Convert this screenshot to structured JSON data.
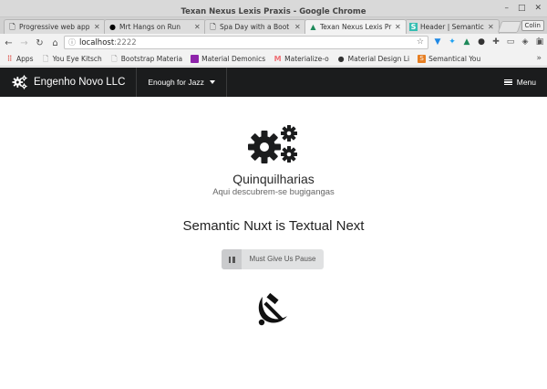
{
  "window": {
    "title": "Texan Nexus Lexis Praxis - Google Chrome"
  },
  "tabs": [
    {
      "label": "Progressive web app",
      "icon": "page-icon",
      "active": false
    },
    {
      "label": "Mrt Hangs on Run",
      "icon": "github-icon",
      "active": false
    },
    {
      "label": "Spa Day with a Boot",
      "icon": "page-icon",
      "active": false
    },
    {
      "label": "Texan Nexus Lexis Pr",
      "icon": "nuxt-icon",
      "active": true
    },
    {
      "label": "Header | Semantic U",
      "icon": "semantic-icon",
      "active": false
    }
  ],
  "profile_badge": "Colin",
  "address": {
    "host": "localhost",
    "port": ":2222"
  },
  "bookmarks": [
    {
      "label": "Apps",
      "icon": "apps-grid-icon",
      "color": "#d93025"
    },
    {
      "label": "You Eye Kitsch",
      "icon": "page-icon",
      "color": "#888888"
    },
    {
      "label": "Bootstrap Materia",
      "icon": "page-icon",
      "color": "#888888"
    },
    {
      "label": "Material Demonics",
      "icon": "material-icon",
      "color": "#8e24aa"
    },
    {
      "label": "Materialize-o",
      "icon": "materialize-icon",
      "color": "#ee6e73"
    },
    {
      "label": "Material Design Li",
      "icon": "github-icon",
      "color": "#333333"
    },
    {
      "label": "Semantical You",
      "icon": "semantic-icon",
      "color": "#e67e22"
    }
  ],
  "navbar": {
    "brand": "Engenho Novo LLC",
    "dropdown": "Enough for Jazz",
    "menu": "Menu"
  },
  "main": {
    "title": "Quinquilharias",
    "subtitle": "Aqui descubrem-se bugigangas",
    "headline": "Semantic Nuxt is Textual Next",
    "button": "Must Give Us Pause"
  },
  "colors": {
    "navbar_bg": "#1b1c1d",
    "button_bg": "#e0e1e2"
  }
}
